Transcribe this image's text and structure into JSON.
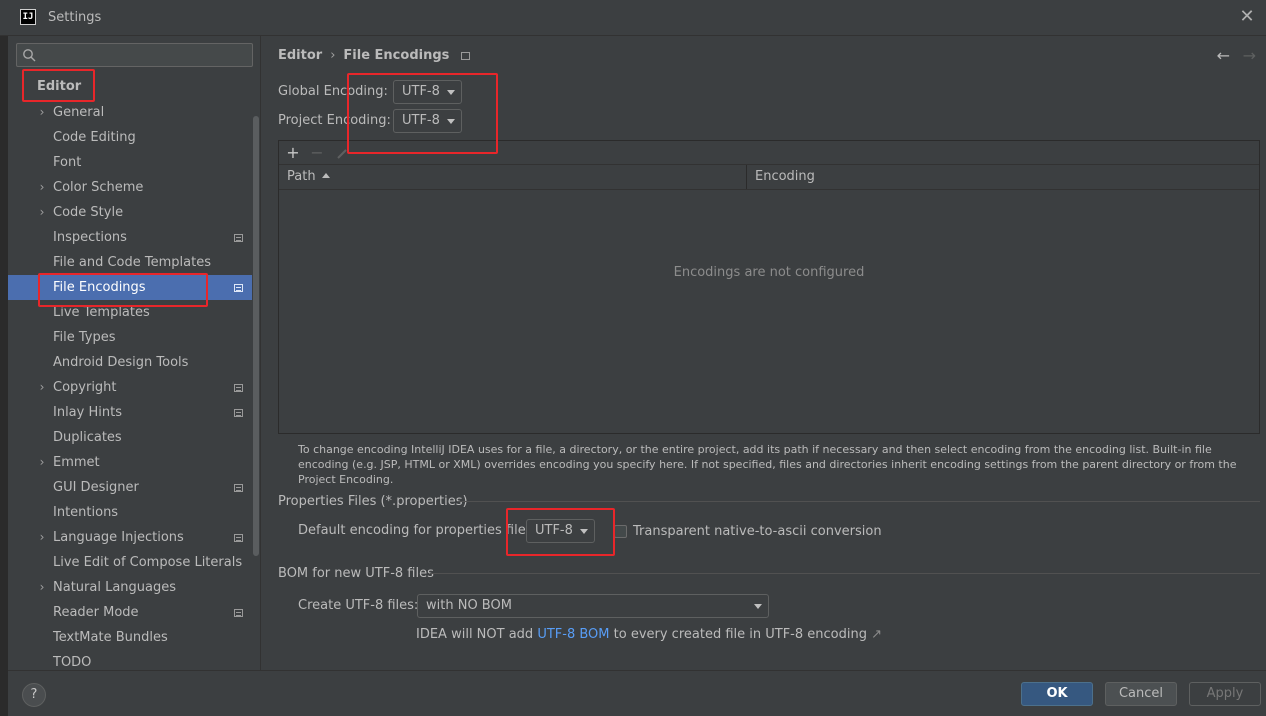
{
  "window": {
    "title": "Settings",
    "app_icon": "IJ"
  },
  "search": {
    "placeholder": "",
    "value": ""
  },
  "sidebar": {
    "root": "Editor",
    "items": [
      {
        "label": "General",
        "expandable": true,
        "page_icon": false
      },
      {
        "label": "Code Editing",
        "expandable": false,
        "page_icon": false
      },
      {
        "label": "Font",
        "expandable": false,
        "page_icon": false
      },
      {
        "label": "Color Scheme",
        "expandable": true,
        "page_icon": false
      },
      {
        "label": "Code Style",
        "expandable": true,
        "page_icon": false
      },
      {
        "label": "Inspections",
        "expandable": false,
        "page_icon": true
      },
      {
        "label": "File and Code Templates",
        "expandable": false,
        "page_icon": false
      },
      {
        "label": "File Encodings",
        "expandable": false,
        "page_icon": true,
        "selected": true
      },
      {
        "label": "Live Templates",
        "expandable": false,
        "page_icon": false
      },
      {
        "label": "File Types",
        "expandable": false,
        "page_icon": false
      },
      {
        "label": "Android Design Tools",
        "expandable": false,
        "page_icon": false
      },
      {
        "label": "Copyright",
        "expandable": true,
        "page_icon": true
      },
      {
        "label": "Inlay Hints",
        "expandable": false,
        "page_icon": true
      },
      {
        "label": "Duplicates",
        "expandable": false,
        "page_icon": false
      },
      {
        "label": "Emmet",
        "expandable": true,
        "page_icon": false
      },
      {
        "label": "GUI Designer",
        "expandable": false,
        "page_icon": true
      },
      {
        "label": "Intentions",
        "expandable": false,
        "page_icon": false
      },
      {
        "label": "Language Injections",
        "expandable": true,
        "page_icon": true
      },
      {
        "label": "Live Edit of Compose Literals",
        "expandable": false,
        "page_icon": false
      },
      {
        "label": "Natural Languages",
        "expandable": true,
        "page_icon": false
      },
      {
        "label": "Reader Mode",
        "expandable": false,
        "page_icon": true
      },
      {
        "label": "TextMate Bundles",
        "expandable": false,
        "page_icon": false
      },
      {
        "label": "TODO",
        "expandable": false,
        "page_icon": false
      }
    ]
  },
  "breadcrumb": {
    "parent": "Editor",
    "separator": "›",
    "current": "File Encodings"
  },
  "nav": {
    "back": "←",
    "forward": "→"
  },
  "encodings": {
    "global_label": "Global Encoding:",
    "global_value": "UTF-8",
    "project_label": "Project Encoding:",
    "project_value": "UTF-8"
  },
  "table": {
    "add": "+",
    "remove": "−",
    "columns": [
      "Path",
      "Encoding"
    ],
    "empty_text": "Encodings are not configured"
  },
  "help_text": "To change encoding IntelliJ IDEA uses for a file, a directory, or the entire project, add its path if necessary and then select encoding from the encoding list. Built-in file encoding (e.g. JSP, HTML or XML) overrides encoding you specify here. If not specified, files and directories inherit encoding settings from the parent directory or from the Project Encoding.",
  "properties": {
    "section_title": "Properties Files (*.properties)",
    "default_label": "Default encoding for properties files:",
    "default_value": "UTF-8",
    "transparent_label": "Transparent native-to-ascii conversion",
    "transparent_checked": false
  },
  "bom": {
    "section_title": "BOM for new UTF-8 files",
    "create_label": "Create UTF-8 files:",
    "create_value": "with NO BOM",
    "note_prefix": "IDEA will NOT add ",
    "note_link": "UTF-8 BOM",
    "note_suffix": " to every created file in UTF-8 encoding",
    "note_arrow": "↗"
  },
  "buttons": {
    "help": "?",
    "ok": "OK",
    "cancel": "Cancel",
    "apply": "Apply"
  },
  "colors": {
    "background": "#3c3f41",
    "selection": "#4b6eaf",
    "ok_button": "#365880",
    "link": "#589df6",
    "annotation_red": "#e8262a"
  }
}
